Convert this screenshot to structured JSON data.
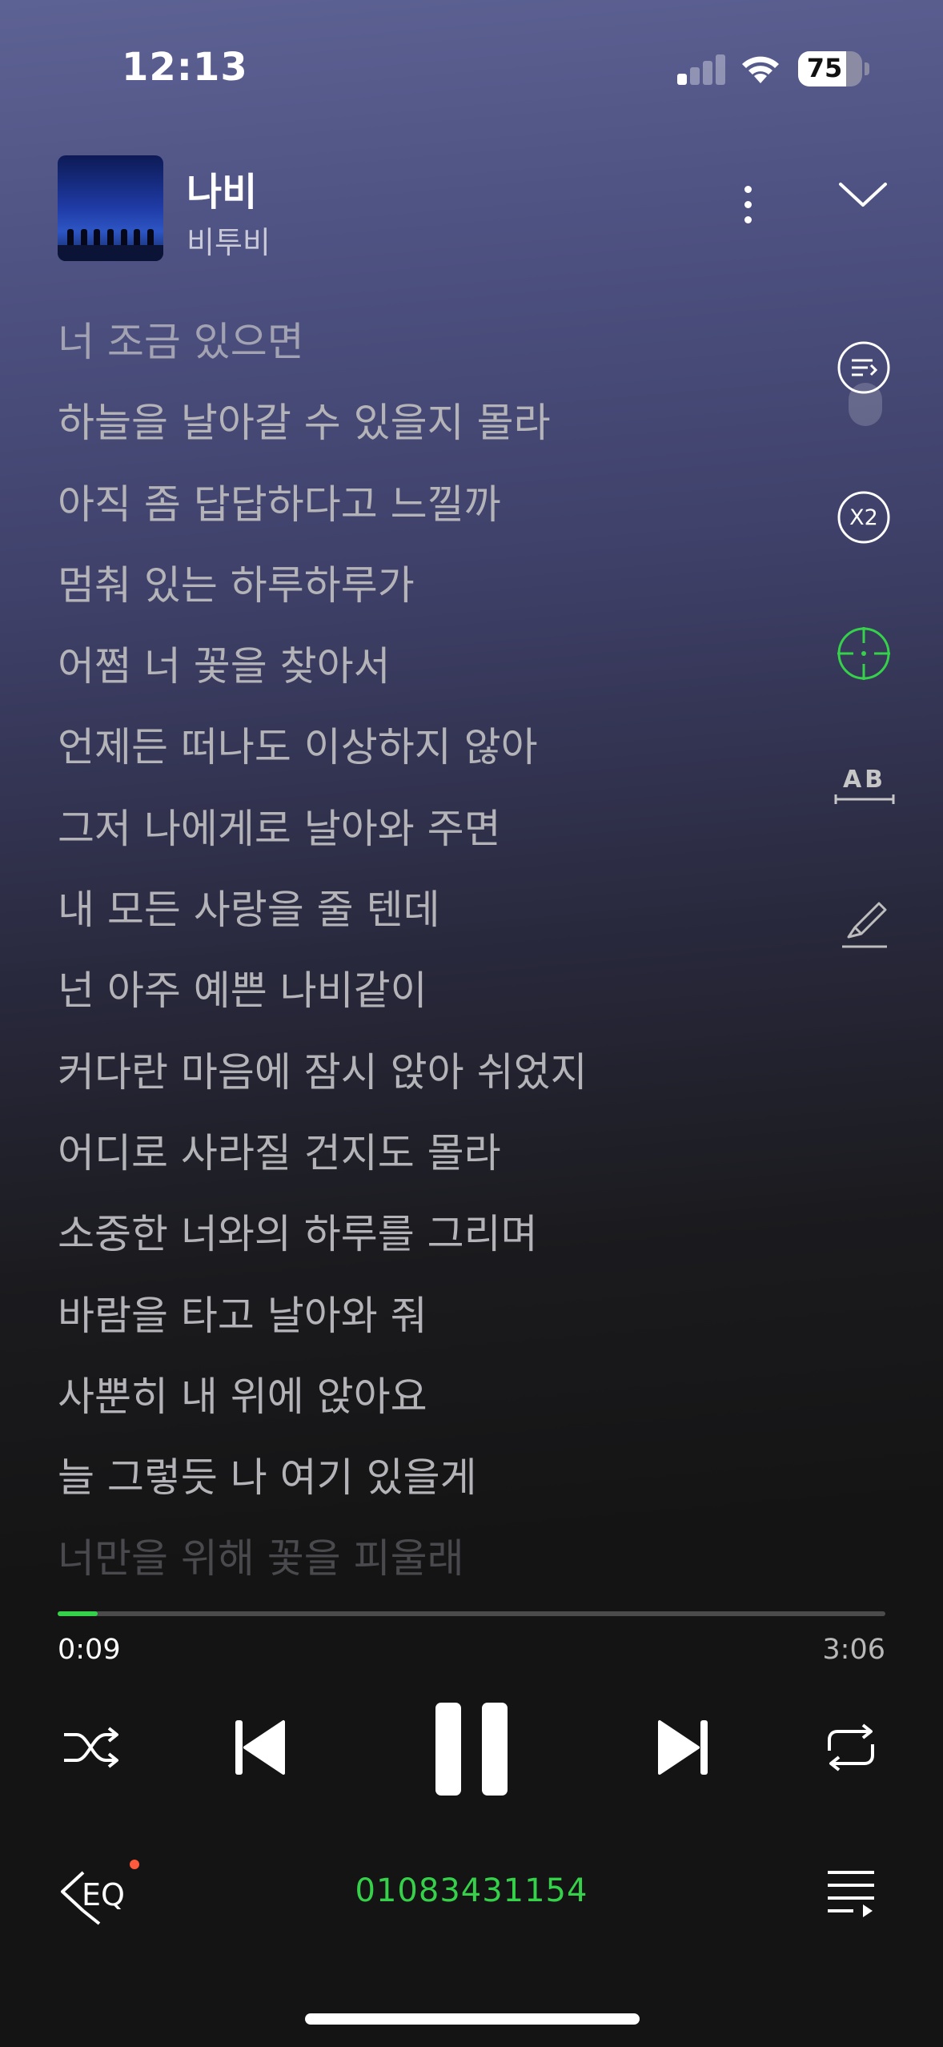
{
  "status_bar": {
    "time": "12:13",
    "battery_percent": "75",
    "battery_level": 0.75,
    "signal_bars_active": 1,
    "signal_bars_total": 4
  },
  "player": {
    "song_title": "나비",
    "artist": "비투비",
    "accent_color": "#36d14a"
  },
  "lyrics": [
    "너 조금 있으면",
    "하늘을 날아갈 수 있을지 몰라",
    "아직 좀 답답하다고 느낄까",
    "멈춰 있는 하루하루가",
    "어쩜 너 꽃을 찾아서",
    "언제든 떠나도 이상하지 않아",
    "그저 나에게로 날아와 주면",
    "내 모든 사랑을 줄 텐데",
    "넌 아주 예쁜 나비같이",
    "커다란 마음에 잠시 앉아 쉬었지",
    "어디로 사라질 건지도 몰라",
    "소중한 너와의 하루를 그리며",
    "바람을 타고 날아와 줘",
    "사뿐히 내 위에 앉아요",
    "늘 그렇듯 나 여기 있을게",
    "너만을 위해 꽃을 피울래"
  ],
  "side_tools": {
    "speed_label": "X2",
    "translate_label": "AB"
  },
  "playback": {
    "current_time": "0:09",
    "total_time": "3:06",
    "progress_fraction": 0.048
  },
  "bottom": {
    "eq_label": "EQ",
    "device_id": "01083431154"
  },
  "icons": {
    "more": "more-vertical-icon",
    "collapse": "chevron-down-icon",
    "lyrics_menu": "lyrics-list-icon",
    "speed": "speed-x2-icon",
    "sync": "crosshair-icon",
    "translate": "translate-ab-icon",
    "highlight": "highlighter-icon",
    "shuffle": "shuffle-icon",
    "previous": "previous-icon",
    "pause": "pause-icon",
    "next": "next-icon",
    "repeat": "repeat-icon",
    "equalizer": "equalizer-icon",
    "playlist": "playlist-icon"
  }
}
